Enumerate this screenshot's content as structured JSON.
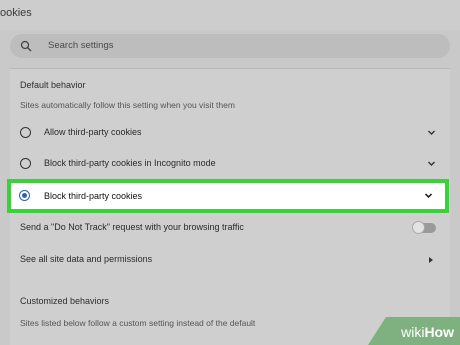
{
  "header": {
    "title": "ookies"
  },
  "search": {
    "placeholder": "Search settings"
  },
  "default_behavior": {
    "title": "Default behavior",
    "description": "Sites automatically follow this setting when you visit them",
    "options": [
      {
        "label": "Allow third-party cookies",
        "selected": false
      },
      {
        "label": "Block third-party cookies in Incognito mode",
        "selected": false
      },
      {
        "label": "Block third-party cookies",
        "selected": true
      }
    ]
  },
  "do_not_track": {
    "label": "Send a \"Do Not Track\" request with your browsing traffic",
    "enabled": false
  },
  "site_data": {
    "label": "See all site data and permissions"
  },
  "customized": {
    "title": "Customized behaviors",
    "description": "Sites listed below follow a custom setting instead of the default"
  },
  "watermark": {
    "wiki": "wiki",
    "how": "How"
  },
  "colors": {
    "highlight_border": "#3ad13a",
    "radio_selected": "#2f5fb8"
  }
}
